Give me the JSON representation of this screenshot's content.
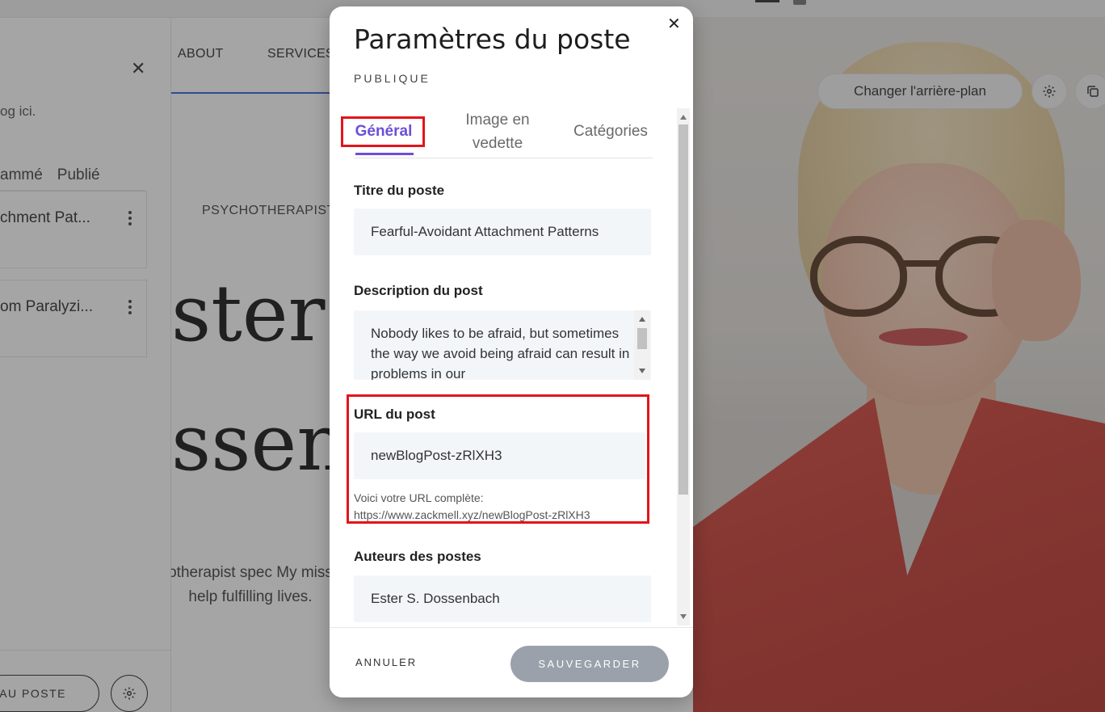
{
  "site": {
    "nav": {
      "about": "ABOUT",
      "services": "SERVICES"
    },
    "hero": {
      "kicker": "PSYCHOTHERAPIST",
      "title_line1": "ster",
      "title_line2": "ssen",
      "text": "d psychotherapist spec My mission is to help fulfilling lives."
    },
    "change_bg_label": "Changer l'arrière-plan",
    "icons": {
      "settings": "gear-icon",
      "duplicate": "copy-icon"
    }
  },
  "panel": {
    "hint": "og ici.",
    "tabs": [
      "ammé",
      "Publié"
    ],
    "posts": [
      {
        "title": "chment Pat..."
      },
      {
        "title": "om Paralyzi..."
      }
    ],
    "new_post_label": "EAU POSTE"
  },
  "modal": {
    "title": "Paramètres du poste",
    "subtitle": "PUBLIQUE",
    "tabs": {
      "general": "Général",
      "image": "Image en vedette",
      "categories": "Catégories"
    },
    "post_title": {
      "label": "Titre du poste",
      "value": "Fearful-Avoidant Attachment Patterns"
    },
    "post_description": {
      "label": "Description du post",
      "value": "Nobody likes to be afraid, but sometimes the way we avoid being afraid can result in problems in our"
    },
    "post_url": {
      "label": "URL du post",
      "value": "newBlogPost-zRlXH3",
      "help_line1": "Voici votre URL complète:",
      "help_line2": "https://www.zackmell.xyz/newBlogPost-zRlXH3"
    },
    "post_authors": {
      "label": "Auteurs des postes",
      "value": "Ester S. Dossenbach"
    },
    "cancel_label": "ANNULER",
    "save_label": "SAUVEGARDER"
  },
  "colors": {
    "accent": "#6b4fd8",
    "highlight": "#e3141a",
    "save_disabled": "#9aa1aa"
  }
}
